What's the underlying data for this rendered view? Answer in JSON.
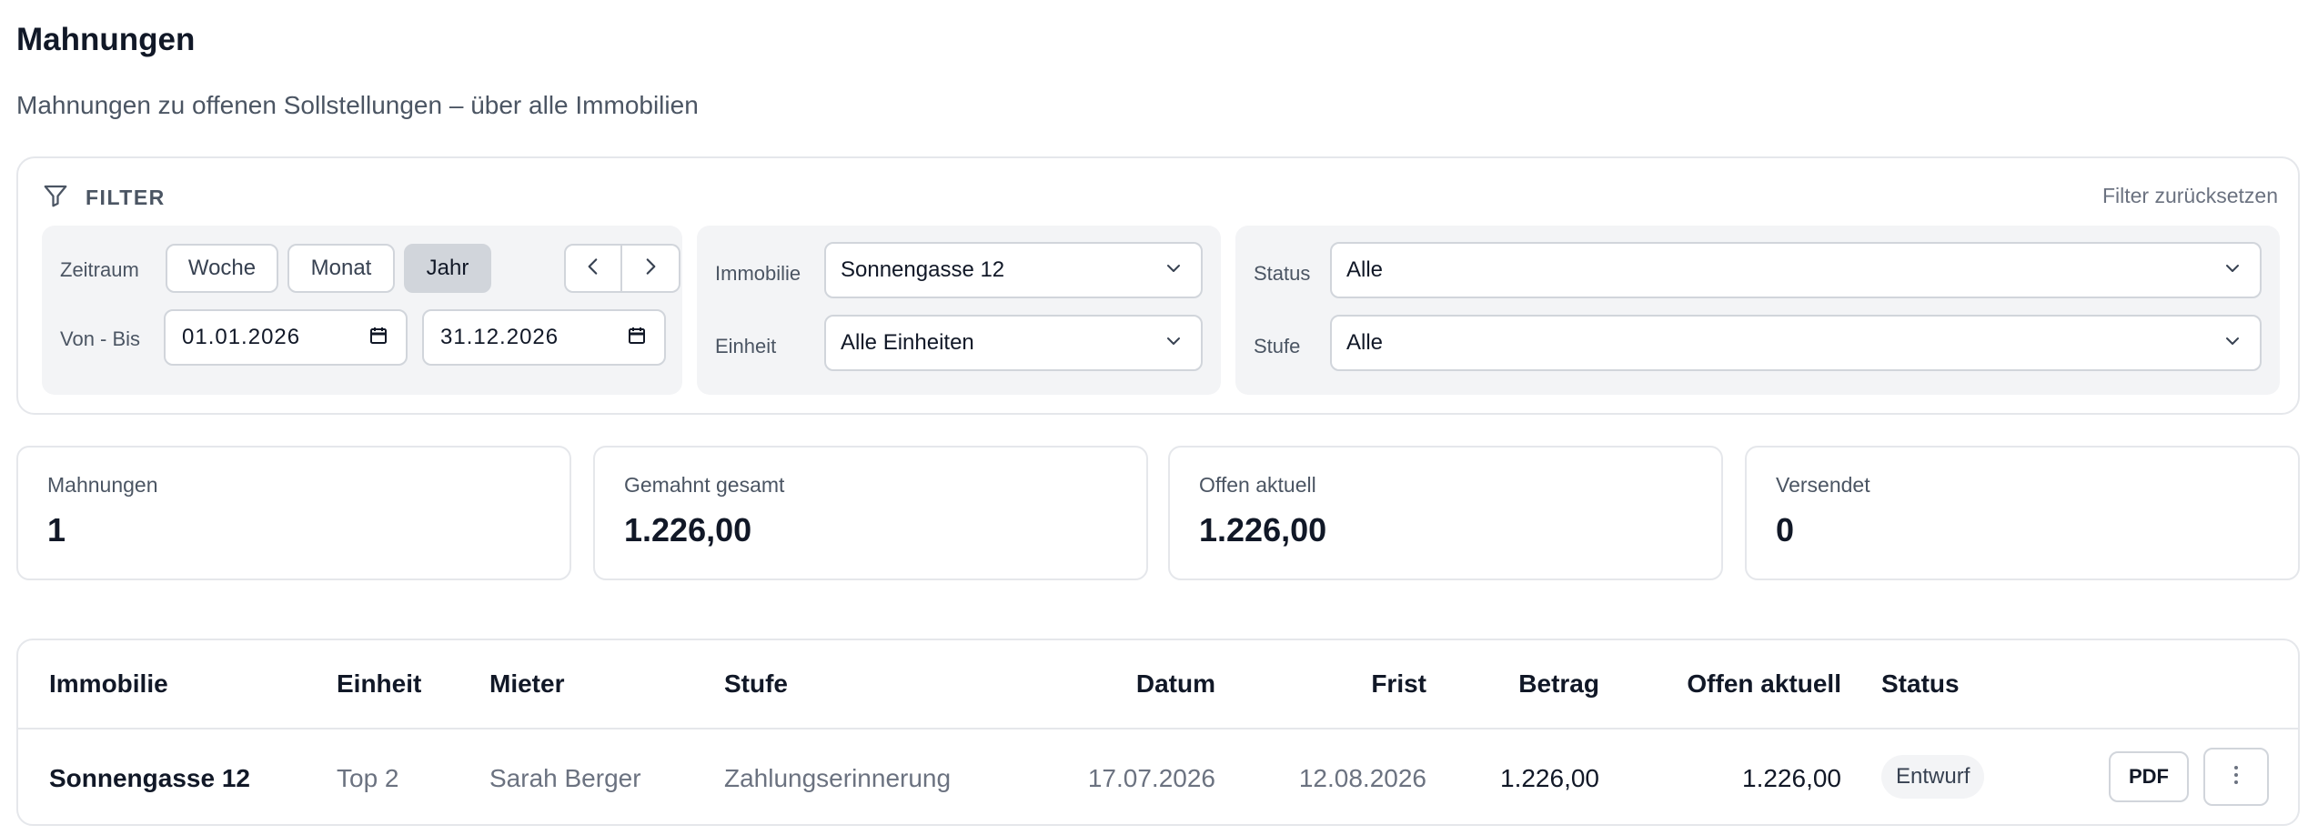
{
  "page": {
    "title": "Mahnungen",
    "subtitle": "Mahnungen zu offenen Sollstellungen – über alle Immobilien"
  },
  "filter": {
    "heading": "FILTER",
    "icon": "funnel-icon",
    "reset_label": "Filter zurücksetzen",
    "zeitraum_label": "Zeitraum",
    "period_options": [
      "Woche",
      "Monat",
      "Jahr"
    ],
    "period_selected": "Jahr",
    "prev_icon": "chevron-left-icon",
    "next_icon": "chevron-right-icon",
    "range_label": "Von - Bis",
    "date_from": "01.01.2026",
    "date_to": "31.12.2026",
    "immobilie_label": "Immobilie",
    "immobilie_value": "Sonnengasse 12",
    "einheit_label": "Einheit",
    "einheit_value": "Alle Einheiten",
    "status_label": "Status",
    "status_value": "Alle",
    "stufe_label": "Stufe",
    "stufe_value": "Alle"
  },
  "stats": [
    {
      "label": "Mahnungen",
      "value": "1"
    },
    {
      "label": "Gemahnt gesamt",
      "value": "1.226,00"
    },
    {
      "label": "Offen aktuell",
      "value": "1.226,00"
    },
    {
      "label": "Versendet",
      "value": "0"
    }
  ],
  "table": {
    "columns": [
      "Immobilie",
      "Einheit",
      "Mieter",
      "Stufe",
      "Datum",
      "Frist",
      "Betrag",
      "Offen aktuell",
      "Status"
    ],
    "rows": [
      {
        "immobilie": "Sonnengasse 12",
        "einheit": "Top 2",
        "mieter": "Sarah Berger",
        "stufe": "Zahlungserinnerung",
        "datum": "17.07.2026",
        "frist": "12.08.2026",
        "betrag": "1.226,00",
        "offen": "1.226,00",
        "status": "Entwurf",
        "pdf_label": "PDF"
      }
    ]
  },
  "colors": {
    "border": "#e5e7eb",
    "panel": "#f3f4f6",
    "active_segment": "#d1d5db",
    "text": "#111827",
    "muted": "#6b7280"
  }
}
